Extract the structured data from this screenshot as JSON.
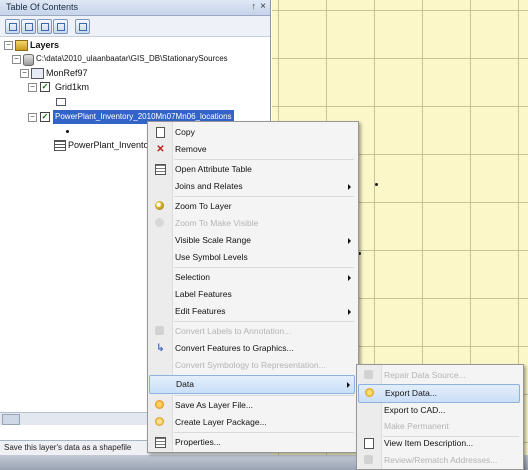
{
  "toc": {
    "title": "Table Of Contents",
    "pin_glyph": "↑",
    "close_glyph": "×",
    "tree": {
      "root_label": "Layers",
      "folder_label": "C:\\data\\2010_ulaanbaatar\\GIS_DB\\StationarySources",
      "dataframe_label": "MonRef97",
      "grid_label": "Grid1km",
      "selected_layer_label": "PowerPlant_Inventory_2010Mn07Mn06_locations",
      "table_label": "PowerPlant_Inventory"
    },
    "status_text": "Save this layer's data as a shapefile"
  },
  "context_menu": {
    "items": [
      {
        "label": "Copy",
        "icon": "copy-icon",
        "enabled": true
      },
      {
        "label": "Remove",
        "icon": "remove-icon",
        "enabled": true
      },
      {
        "label": "Open Attribute Table",
        "icon": "table-icon",
        "enabled": true
      },
      {
        "label": "Joins and Relates",
        "submenu": true,
        "enabled": true
      },
      {
        "label": "Zoom To Layer",
        "icon": "zoom-icon",
        "enabled": true
      },
      {
        "label": "Zoom To Make Visible",
        "icon": "zoom-icon",
        "enabled": false
      },
      {
        "label": "Visible Scale Range",
        "submenu": true,
        "enabled": true
      },
      {
        "label": "Use Symbol Levels",
        "enabled": true
      },
      {
        "label": "Selection",
        "submenu": true,
        "enabled": true
      },
      {
        "label": "Label Features",
        "enabled": true
      },
      {
        "label": "Edit Features",
        "submenu": true,
        "enabled": true
      },
      {
        "label": "Convert Labels to Annotation...",
        "enabled": false
      },
      {
        "label": "Convert Features to Graphics...",
        "icon": "convert-icon",
        "enabled": true
      },
      {
        "label": "Convert Symbology to Representation...",
        "enabled": false
      },
      {
        "label": "Data",
        "submenu": true,
        "enabled": true,
        "highlighted": true
      },
      {
        "label": "Save As Layer File...",
        "icon": "save-icon",
        "enabled": true
      },
      {
        "label": "Create Layer Package...",
        "icon": "package-icon",
        "enabled": true
      },
      {
        "label": "Properties...",
        "icon": "properties-icon",
        "enabled": true
      }
    ]
  },
  "data_submenu": {
    "items": [
      {
        "label": "Repair Data Source...",
        "enabled": false
      },
      {
        "label": "Export Data...",
        "icon": "export-icon",
        "enabled": true,
        "highlighted": true
      },
      {
        "label": "Export to CAD...",
        "enabled": true
      },
      {
        "label": "Make Permanent",
        "enabled": false
      },
      {
        "label": "View Item Description...",
        "icon": "description-icon",
        "enabled": true
      },
      {
        "label": "Review/Rematch Addresses...",
        "enabled": false
      }
    ]
  },
  "colors": {
    "map_background": "#fbf7c8",
    "selection": "#3264c8",
    "menu_highlight": "#cadff8"
  }
}
